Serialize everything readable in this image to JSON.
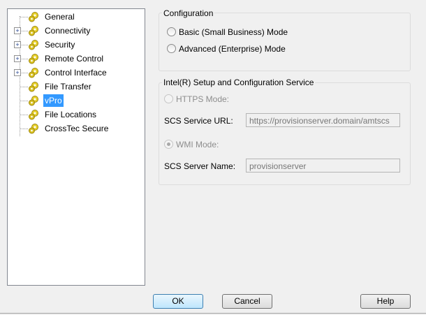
{
  "tree": {
    "items": [
      {
        "label": "General",
        "expandable": false
      },
      {
        "label": "Connectivity",
        "expandable": true
      },
      {
        "label": "Security",
        "expandable": true
      },
      {
        "label": "Remote Control",
        "expandable": true
      },
      {
        "label": "Control Interface",
        "expandable": true
      },
      {
        "label": "File Transfer",
        "expandable": false
      },
      {
        "label": "vPro",
        "expandable": false,
        "selected": true
      },
      {
        "label": "File Locations",
        "expandable": false
      },
      {
        "label": "CrossTec Secure",
        "expandable": false
      }
    ]
  },
  "configuration": {
    "title": "Configuration",
    "basic": "Basic (Small Business) Mode",
    "advanced": "Advanced (Enterprise) Mode"
  },
  "scs": {
    "title": "Intel(R) Setup and Configuration Service",
    "https_mode": "HTTPS Mode:",
    "url_label": "SCS Service URL:",
    "url_value": "https://provisionserver.domain/amtscs",
    "wmi_mode": "WMI Mode:",
    "server_label": "SCS Server Name:",
    "server_value": "provisionserver"
  },
  "buttons": {
    "ok": "OK",
    "cancel": "Cancel",
    "help": "Help"
  }
}
